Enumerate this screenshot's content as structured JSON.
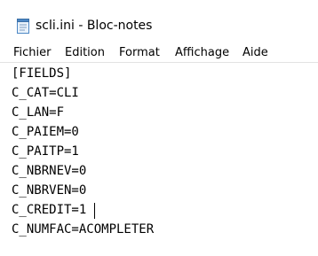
{
  "window": {
    "title": "scli.ini - Bloc-notes",
    "icon": "notepad-icon"
  },
  "menu": {
    "items": [
      {
        "label": "Fichier"
      },
      {
        "label": "Edition"
      },
      {
        "label": "Format"
      },
      {
        "label": "Affichage"
      },
      {
        "label": "Aide"
      }
    ]
  },
  "editor": {
    "lines": [
      "[FIELDS]",
      "C_CAT=CLI",
      "C_LAN=F",
      "C_PAIEM=0",
      "C_PAITP=1",
      "C_NBRNEV=0",
      "C_NBRVEN=0",
      "C_CREDIT=1",
      "C_NUMFAC=ACOMPLETER"
    ],
    "caret_line": 7,
    "caret_column": 11
  }
}
